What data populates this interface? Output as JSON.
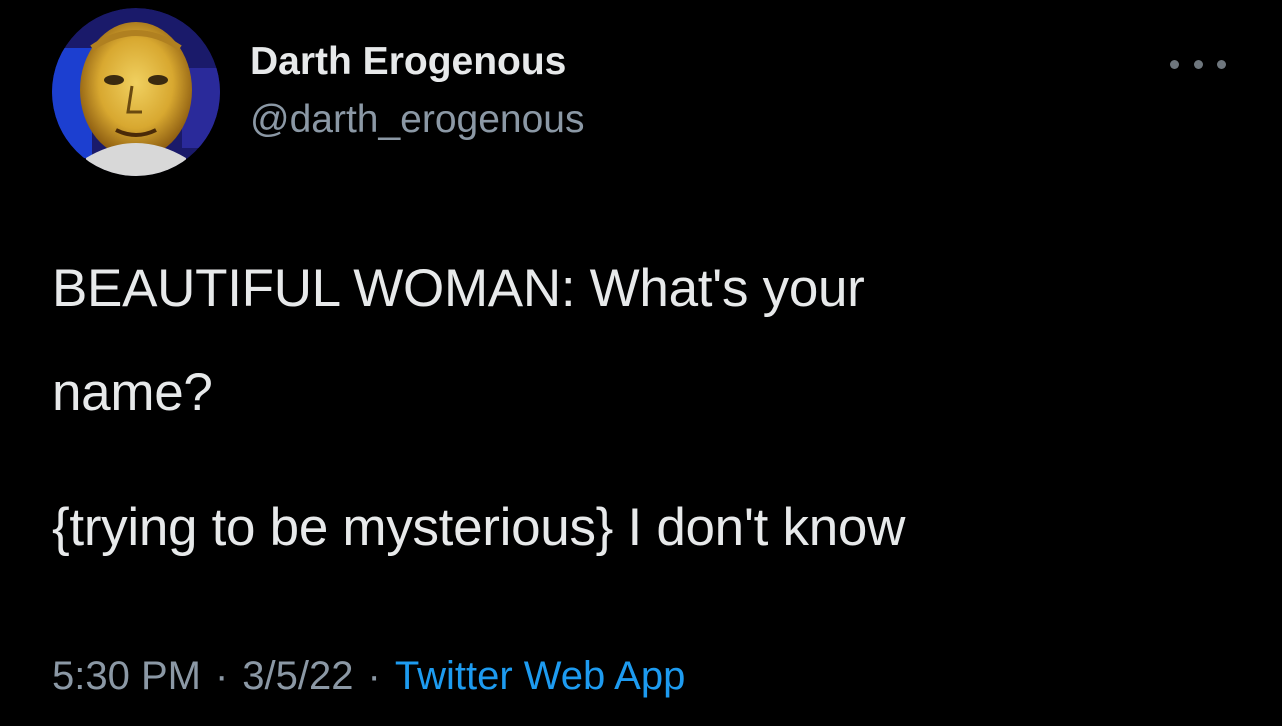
{
  "author": {
    "display_name": "Darth Erogenous",
    "handle": "@darth_erogenous",
    "avatar_icon": "avatar-portrait-icon"
  },
  "menu": {
    "icon": "more-options-icon"
  },
  "tweet": {
    "line1": "BEAUTIFUL WOMAN: What's your",
    "line2": "name?",
    "line3": "{trying to be mysterious} I don't know"
  },
  "meta": {
    "time": "5:30 PM",
    "date": "3/5/22",
    "separator": "·",
    "source": "Twitter Web App"
  },
  "colors": {
    "background": "#000000",
    "text": "#e7e9ea",
    "secondary": "#8b98a5",
    "link": "#1d9bf0"
  }
}
